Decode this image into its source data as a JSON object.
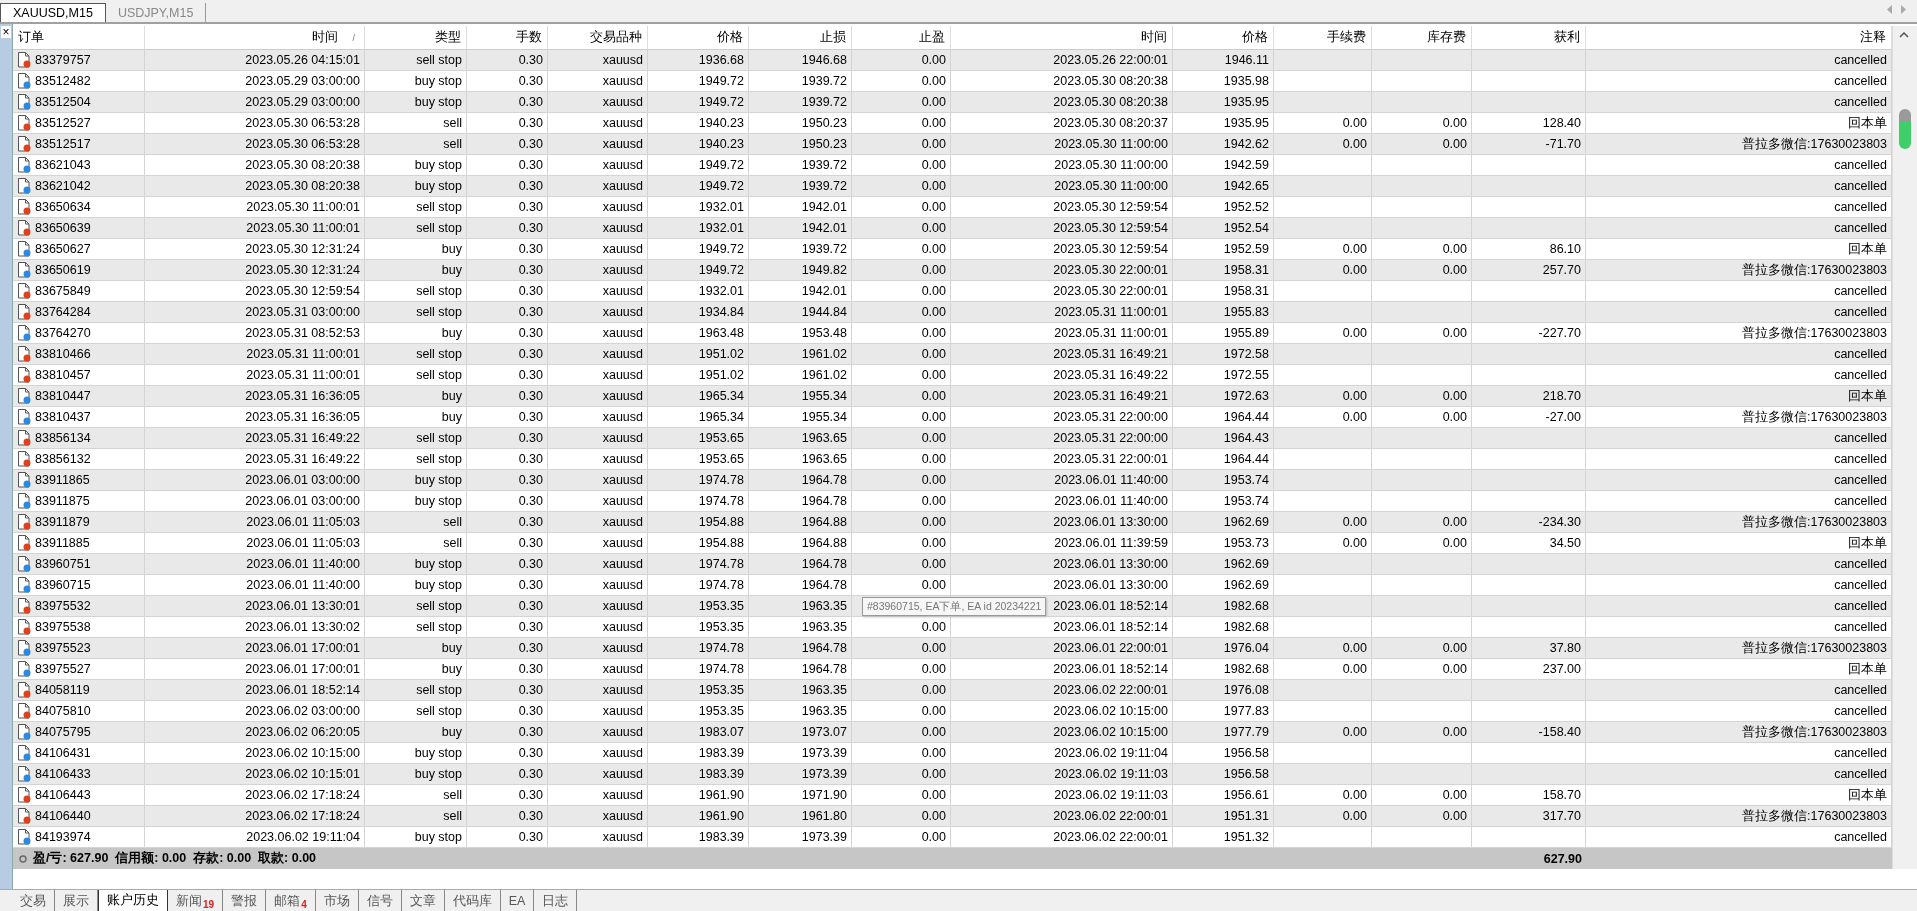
{
  "chart_tabs": [
    {
      "label": "XAUUSD,M15",
      "selected": true
    },
    {
      "label": "USDJPY,M15",
      "selected": false
    }
  ],
  "columns": [
    "订单",
    "时间",
    "类型",
    "手数",
    "交易品种",
    "价格",
    "止损",
    "止盈",
    "时间",
    "价格",
    "手续费",
    "库存费",
    "获利",
    "注释"
  ],
  "sort_mark": "/",
  "close_glyph": "×",
  "rows": [
    {
      "color": "#e0401c",
      "order": "83379757",
      "open_time": "2023.05.26 04:15:01",
      "type": "sell stop",
      "lots": "0.30",
      "symbol": "xauusd",
      "price": "1936.68",
      "sl": "1946.68",
      "tp": "0.00",
      "close_time": "2023.05.26 22:00:01",
      "close_price": "1946.11",
      "comment": "cancelled"
    },
    {
      "color": "#2a8ae0",
      "order": "83512482",
      "open_time": "2023.05.29 03:00:00",
      "type": "buy stop",
      "lots": "0.30",
      "symbol": "xauusd",
      "price": "1949.72",
      "sl": "1939.72",
      "tp": "0.00",
      "close_time": "2023.05.30 08:20:38",
      "close_price": "1935.98",
      "comment": "cancelled"
    },
    {
      "color": "#2a8ae0",
      "order": "83512504",
      "open_time": "2023.05.29 03:00:00",
      "type": "buy stop",
      "lots": "0.30",
      "symbol": "xauusd",
      "price": "1949.72",
      "sl": "1939.72",
      "tp": "0.00",
      "close_time": "2023.05.30 08:20:38",
      "close_price": "1935.95",
      "comment": "cancelled"
    },
    {
      "color": "#e0401c",
      "order": "83512527",
      "open_time": "2023.05.30 06:53:28",
      "type": "sell",
      "lots": "0.30",
      "symbol": "xauusd",
      "price": "1940.23",
      "sl": "1950.23",
      "tp": "0.00",
      "close_time": "2023.05.30 08:20:37",
      "close_price": "1935.95",
      "commission": "0.00",
      "swap": "0.00",
      "profit": "128.40",
      "comment": "回本单"
    },
    {
      "color": "#e0401c",
      "order": "83512517",
      "open_time": "2023.05.30 06:53:28",
      "type": "sell",
      "lots": "0.30",
      "symbol": "xauusd",
      "price": "1940.23",
      "sl": "1950.23",
      "tp": "0.00",
      "close_time": "2023.05.30 11:00:00",
      "close_price": "1942.62",
      "commission": "0.00",
      "swap": "0.00",
      "profit": "-71.70",
      "comment": "普拉多微信:17630023803"
    },
    {
      "color": "#2a8ae0",
      "order": "83621043",
      "open_time": "2023.05.30 08:20:38",
      "type": "buy stop",
      "lots": "0.30",
      "symbol": "xauusd",
      "price": "1949.72",
      "sl": "1939.72",
      "tp": "0.00",
      "close_time": "2023.05.30 11:00:00",
      "close_price": "1942.59",
      "comment": "cancelled"
    },
    {
      "color": "#2a8ae0",
      "order": "83621042",
      "open_time": "2023.05.30 08:20:38",
      "type": "buy stop",
      "lots": "0.30",
      "symbol": "xauusd",
      "price": "1949.72",
      "sl": "1939.72",
      "tp": "0.00",
      "close_time": "2023.05.30 11:00:00",
      "close_price": "1942.65",
      "comment": "cancelled"
    },
    {
      "color": "#e0401c",
      "order": "83650634",
      "open_time": "2023.05.30 11:00:01",
      "type": "sell stop",
      "lots": "0.30",
      "symbol": "xauusd",
      "price": "1932.01",
      "sl": "1942.01",
      "tp": "0.00",
      "close_time": "2023.05.30 12:59:54",
      "close_price": "1952.52",
      "comment": "cancelled"
    },
    {
      "color": "#e0401c",
      "order": "83650639",
      "open_time": "2023.05.30 11:00:01",
      "type": "sell stop",
      "lots": "0.30",
      "symbol": "xauusd",
      "price": "1932.01",
      "sl": "1942.01",
      "tp": "0.00",
      "close_time": "2023.05.30 12:59:54",
      "close_price": "1952.54",
      "comment": "cancelled"
    },
    {
      "color": "#2a8ae0",
      "order": "83650627",
      "open_time": "2023.05.30 12:31:24",
      "type": "buy",
      "lots": "0.30",
      "symbol": "xauusd",
      "price": "1949.72",
      "sl": "1939.72",
      "tp": "0.00",
      "close_time": "2023.05.30 12:59:54",
      "close_price": "1952.59",
      "commission": "0.00",
      "swap": "0.00",
      "profit": "86.10",
      "comment": "回本单"
    },
    {
      "color": "#2a8ae0",
      "order": "83650619",
      "open_time": "2023.05.30 12:31:24",
      "type": "buy",
      "lots": "0.30",
      "symbol": "xauusd",
      "price": "1949.72",
      "sl": "1949.82",
      "tp": "0.00",
      "close_time": "2023.05.30 22:00:01",
      "close_price": "1958.31",
      "commission": "0.00",
      "swap": "0.00",
      "profit": "257.70",
      "comment": "普拉多微信:17630023803"
    },
    {
      "color": "#e0401c",
      "order": "83675849",
      "open_time": "2023.05.30 12:59:54",
      "type": "sell stop",
      "lots": "0.30",
      "symbol": "xauusd",
      "price": "1932.01",
      "sl": "1942.01",
      "tp": "0.00",
      "close_time": "2023.05.30 22:00:01",
      "close_price": "1958.31",
      "comment": "cancelled"
    },
    {
      "color": "#e0401c",
      "order": "83764284",
      "open_time": "2023.05.31 03:00:00",
      "type": "sell stop",
      "lots": "0.30",
      "symbol": "xauusd",
      "price": "1934.84",
      "sl": "1944.84",
      "tp": "0.00",
      "close_time": "2023.05.31 11:00:01",
      "close_price": "1955.83",
      "comment": "cancelled"
    },
    {
      "color": "#2a8ae0",
      "order": "83764270",
      "open_time": "2023.05.31 08:52:53",
      "type": "buy",
      "lots": "0.30",
      "symbol": "xauusd",
      "price": "1963.48",
      "sl": "1953.48",
      "tp": "0.00",
      "close_time": "2023.05.31 11:00:01",
      "close_price": "1955.89",
      "commission": "0.00",
      "swap": "0.00",
      "profit": "-227.70",
      "comment": "普拉多微信:17630023803"
    },
    {
      "color": "#e0401c",
      "order": "83810466",
      "open_time": "2023.05.31 11:00:01",
      "type": "sell stop",
      "lots": "0.30",
      "symbol": "xauusd",
      "price": "1951.02",
      "sl": "1961.02",
      "tp": "0.00",
      "close_time": "2023.05.31 16:49:21",
      "close_price": "1972.58",
      "comment": "cancelled"
    },
    {
      "color": "#e0401c",
      "order": "83810457",
      "open_time": "2023.05.31 11:00:01",
      "type": "sell stop",
      "lots": "0.30",
      "symbol": "xauusd",
      "price": "1951.02",
      "sl": "1961.02",
      "tp": "0.00",
      "close_time": "2023.05.31 16:49:22",
      "close_price": "1972.55",
      "comment": "cancelled"
    },
    {
      "color": "#2a8ae0",
      "order": "83810447",
      "open_time": "2023.05.31 16:36:05",
      "type": "buy",
      "lots": "0.30",
      "symbol": "xauusd",
      "price": "1965.34",
      "sl": "1955.34",
      "tp": "0.00",
      "close_time": "2023.05.31 16:49:21",
      "close_price": "1972.63",
      "commission": "0.00",
      "swap": "0.00",
      "profit": "218.70",
      "comment": "回本单"
    },
    {
      "color": "#2a8ae0",
      "order": "83810437",
      "open_time": "2023.05.31 16:36:05",
      "type": "buy",
      "lots": "0.30",
      "symbol": "xauusd",
      "price": "1965.34",
      "sl": "1955.34",
      "tp": "0.00",
      "close_time": "2023.05.31 22:00:00",
      "close_price": "1964.44",
      "commission": "0.00",
      "swap": "0.00",
      "profit": "-27.00",
      "comment": "普拉多微信:17630023803"
    },
    {
      "color": "#e0401c",
      "order": "83856134",
      "open_time": "2023.05.31 16:49:22",
      "type": "sell stop",
      "lots": "0.30",
      "symbol": "xauusd",
      "price": "1953.65",
      "sl": "1963.65",
      "tp": "0.00",
      "close_time": "2023.05.31 22:00:00",
      "close_price": "1964.43",
      "comment": "cancelled"
    },
    {
      "color": "#e0401c",
      "order": "83856132",
      "open_time": "2023.05.31 16:49:22",
      "type": "sell stop",
      "lots": "0.30",
      "symbol": "xauusd",
      "price": "1953.65",
      "sl": "1963.65",
      "tp": "0.00",
      "close_time": "2023.05.31 22:00:01",
      "close_price": "1964.44",
      "comment": "cancelled"
    },
    {
      "color": "#2a8ae0",
      "order": "83911865",
      "open_time": "2023.06.01 03:00:00",
      "type": "buy stop",
      "lots": "0.30",
      "symbol": "xauusd",
      "price": "1974.78",
      "sl": "1964.78",
      "tp": "0.00",
      "close_time": "2023.06.01 11:40:00",
      "close_price": "1953.74",
      "comment": "cancelled"
    },
    {
      "color": "#2a8ae0",
      "order": "83911875",
      "open_time": "2023.06.01 03:00:00",
      "type": "buy stop",
      "lots": "0.30",
      "symbol": "xauusd",
      "price": "1974.78",
      "sl": "1964.78",
      "tp": "0.00",
      "close_time": "2023.06.01 11:40:00",
      "close_price": "1953.74",
      "comment": "cancelled"
    },
    {
      "color": "#e0401c",
      "order": "83911879",
      "open_time": "2023.06.01 11:05:03",
      "type": "sell",
      "lots": "0.30",
      "symbol": "xauusd",
      "price": "1954.88",
      "sl": "1964.88",
      "tp": "0.00",
      "close_time": "2023.06.01 13:30:00",
      "close_price": "1962.69",
      "commission": "0.00",
      "swap": "0.00",
      "profit": "-234.30",
      "comment": "普拉多微信:17630023803"
    },
    {
      "color": "#e0401c",
      "order": "83911885",
      "open_time": "2023.06.01 11:05:03",
      "type": "sell",
      "lots": "0.30",
      "symbol": "xauusd",
      "price": "1954.88",
      "sl": "1964.88",
      "tp": "0.00",
      "close_time": "2023.06.01 11:39:59",
      "close_price": "1953.73",
      "commission": "0.00",
      "swap": "0.00",
      "profit": "34.50",
      "comment": "回本单"
    },
    {
      "color": "#2a8ae0",
      "order": "83960751",
      "open_time": "2023.06.01 11:40:00",
      "type": "buy stop",
      "lots": "0.30",
      "symbol": "xauusd",
      "price": "1974.78",
      "sl": "1964.78",
      "tp": "0.00",
      "close_time": "2023.06.01 13:30:00",
      "close_price": "1962.69",
      "comment": "cancelled"
    },
    {
      "color": "#2a8ae0",
      "order": "83960715",
      "open_time": "2023.06.01 11:40:00",
      "type": "buy stop",
      "lots": "0.30",
      "symbol": "xauusd",
      "price": "1974.78",
      "sl": "1964.78",
      "tp": "0.00",
      "close_time": "2023.06.01 13:30:00",
      "close_price": "1962.69",
      "comment": "cancelled"
    },
    {
      "color": "#e0401c",
      "order": "83975532",
      "open_time": "2023.06.01 13:30:01",
      "type": "sell stop",
      "lots": "0.30",
      "symbol": "xauusd",
      "price": "1953.35",
      "sl": "1963.35",
      "close_time": "2023.06.01 18:52:14",
      "close_price": "1982.68",
      "comment": "cancelled"
    },
    {
      "color": "#e0401c",
      "order": "83975538",
      "open_time": "2023.06.01 13:30:02",
      "type": "sell stop",
      "lots": "0.30",
      "symbol": "xauusd",
      "price": "1953.35",
      "sl": "1963.35",
      "tp": "0.00",
      "close_time": "2023.06.01 18:52:14",
      "close_price": "1982.68",
      "comment": "cancelled"
    },
    {
      "color": "#2a8ae0",
      "order": "83975523",
      "open_time": "2023.06.01 17:00:01",
      "type": "buy",
      "lots": "0.30",
      "symbol": "xauusd",
      "price": "1974.78",
      "sl": "1964.78",
      "tp": "0.00",
      "close_time": "2023.06.01 22:00:01",
      "close_price": "1976.04",
      "commission": "0.00",
      "swap": "0.00",
      "profit": "37.80",
      "comment": "普拉多微信:17630023803"
    },
    {
      "color": "#2a8ae0",
      "order": "83975527",
      "open_time": "2023.06.01 17:00:01",
      "type": "buy",
      "lots": "0.30",
      "symbol": "xauusd",
      "price": "1974.78",
      "sl": "1964.78",
      "tp": "0.00",
      "close_time": "2023.06.01 18:52:14",
      "close_price": "1982.68",
      "commission": "0.00",
      "swap": "0.00",
      "profit": "237.00",
      "comment": "回本单"
    },
    {
      "color": "#e0401c",
      "order": "84058119",
      "open_time": "2023.06.01 18:52:14",
      "type": "sell stop",
      "lots": "0.30",
      "symbol": "xauusd",
      "price": "1953.35",
      "sl": "1963.35",
      "tp": "0.00",
      "close_time": "2023.06.02 22:00:01",
      "close_price": "1976.08",
      "comment": "cancelled"
    },
    {
      "color": "#e0401c",
      "order": "84075810",
      "open_time": "2023.06.02 03:00:00",
      "type": "sell stop",
      "lots": "0.30",
      "symbol": "xauusd",
      "price": "1953.35",
      "sl": "1963.35",
      "tp": "0.00",
      "close_time": "2023.06.02 10:15:00",
      "close_price": "1977.83",
      "comment": "cancelled"
    },
    {
      "color": "#2a8ae0",
      "order": "84075795",
      "open_time": "2023.06.02 06:20:05",
      "type": "buy",
      "lots": "0.30",
      "symbol": "xauusd",
      "price": "1983.07",
      "sl": "1973.07",
      "tp": "0.00",
      "close_time": "2023.06.02 10:15:00",
      "close_price": "1977.79",
      "commission": "0.00",
      "swap": "0.00",
      "profit": "-158.40",
      "comment": "普拉多微信:17630023803"
    },
    {
      "color": "#2a8ae0",
      "order": "84106431",
      "open_time": "2023.06.02 10:15:00",
      "type": "buy stop",
      "lots": "0.30",
      "symbol": "xauusd",
      "price": "1983.39",
      "sl": "1973.39",
      "tp": "0.00",
      "close_time": "2023.06.02 19:11:04",
      "close_price": "1956.58",
      "comment": "cancelled"
    },
    {
      "color": "#2a8ae0",
      "order": "84106433",
      "open_time": "2023.06.02 10:15:01",
      "type": "buy stop",
      "lots": "0.30",
      "symbol": "xauusd",
      "price": "1983.39",
      "sl": "1973.39",
      "tp": "0.00",
      "close_time": "2023.06.02 19:11:03",
      "close_price": "1956.58",
      "comment": "cancelled"
    },
    {
      "color": "#e0401c",
      "order": "84106443",
      "open_time": "2023.06.02 17:18:24",
      "type": "sell",
      "lots": "0.30",
      "symbol": "xauusd",
      "price": "1961.90",
      "sl": "1971.90",
      "tp": "0.00",
      "close_time": "2023.06.02 19:11:03",
      "close_price": "1956.61",
      "commission": "0.00",
      "swap": "0.00",
      "profit": "158.70",
      "comment": "回本单"
    },
    {
      "color": "#e0401c",
      "order": "84106440",
      "open_time": "2023.06.02 17:18:24",
      "type": "sell",
      "lots": "0.30",
      "symbol": "xauusd",
      "price": "1961.90",
      "sl": "1961.80",
      "tp": "0.00",
      "close_time": "2023.06.02 22:00:01",
      "close_price": "1951.31",
      "commission": "0.00",
      "swap": "0.00",
      "profit": "317.70",
      "comment": "普拉多微信:17630023803"
    },
    {
      "color": "#2a8ae0",
      "order": "84193974",
      "open_time": "2023.06.02 19:11:04",
      "type": "buy stop",
      "lots": "0.30",
      "symbol": "xauusd",
      "price": "1983.39",
      "sl": "1973.39",
      "tp": "0.00",
      "close_time": "2023.06.02 22:00:01",
      "close_price": "1951.32",
      "comment": "cancelled"
    }
  ],
  "summary": {
    "text": "盈/亏: 627.90  信用额: 0.00  存款: 0.00  取款: 0.00",
    "profit": "627.90"
  },
  "tooltip": "#83960715, EA下单, EA id 20234221",
  "bottom_tabs": [
    {
      "label": "交易",
      "selected": false
    },
    {
      "label": "展示",
      "selected": false
    },
    {
      "label": "账户历史",
      "selected": true
    },
    {
      "label": "新闻",
      "badge": "19",
      "selected": false
    },
    {
      "label": "警报",
      "selected": false
    },
    {
      "label": "邮箱",
      "badge": "4",
      "selected": false
    },
    {
      "label": "市场",
      "selected": false
    },
    {
      "label": "信号",
      "selected": false
    },
    {
      "label": "文章",
      "selected": false
    },
    {
      "label": "代码库",
      "selected": false
    },
    {
      "label": "EA",
      "selected": false
    },
    {
      "label": "日志",
      "selected": false
    }
  ]
}
